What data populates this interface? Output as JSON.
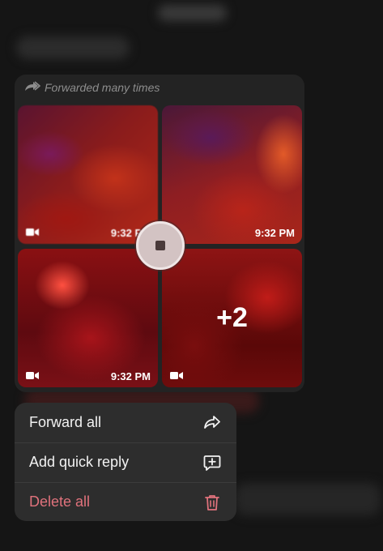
{
  "message": {
    "forwarded_label": "Forwarded many times",
    "tiles": [
      {
        "time": "9:32 PM"
      },
      {
        "time": "9:32 PM"
      },
      {
        "time": "9:32 PM"
      },
      {
        "overlay_count": "+2"
      }
    ]
  },
  "playback": {
    "icon": "stop-icon"
  },
  "context_menu": {
    "items": [
      {
        "label": "Forward all",
        "icon": "forward-arrow-icon"
      },
      {
        "label": "Add quick reply",
        "icon": "quick-reply-icon"
      },
      {
        "label": "Delete all",
        "icon": "trash-icon",
        "color": "#e0727c"
      }
    ]
  },
  "colors": {
    "menu_background": "#2d2d2d",
    "danger": "#e0727c",
    "card_background": "#232323"
  }
}
